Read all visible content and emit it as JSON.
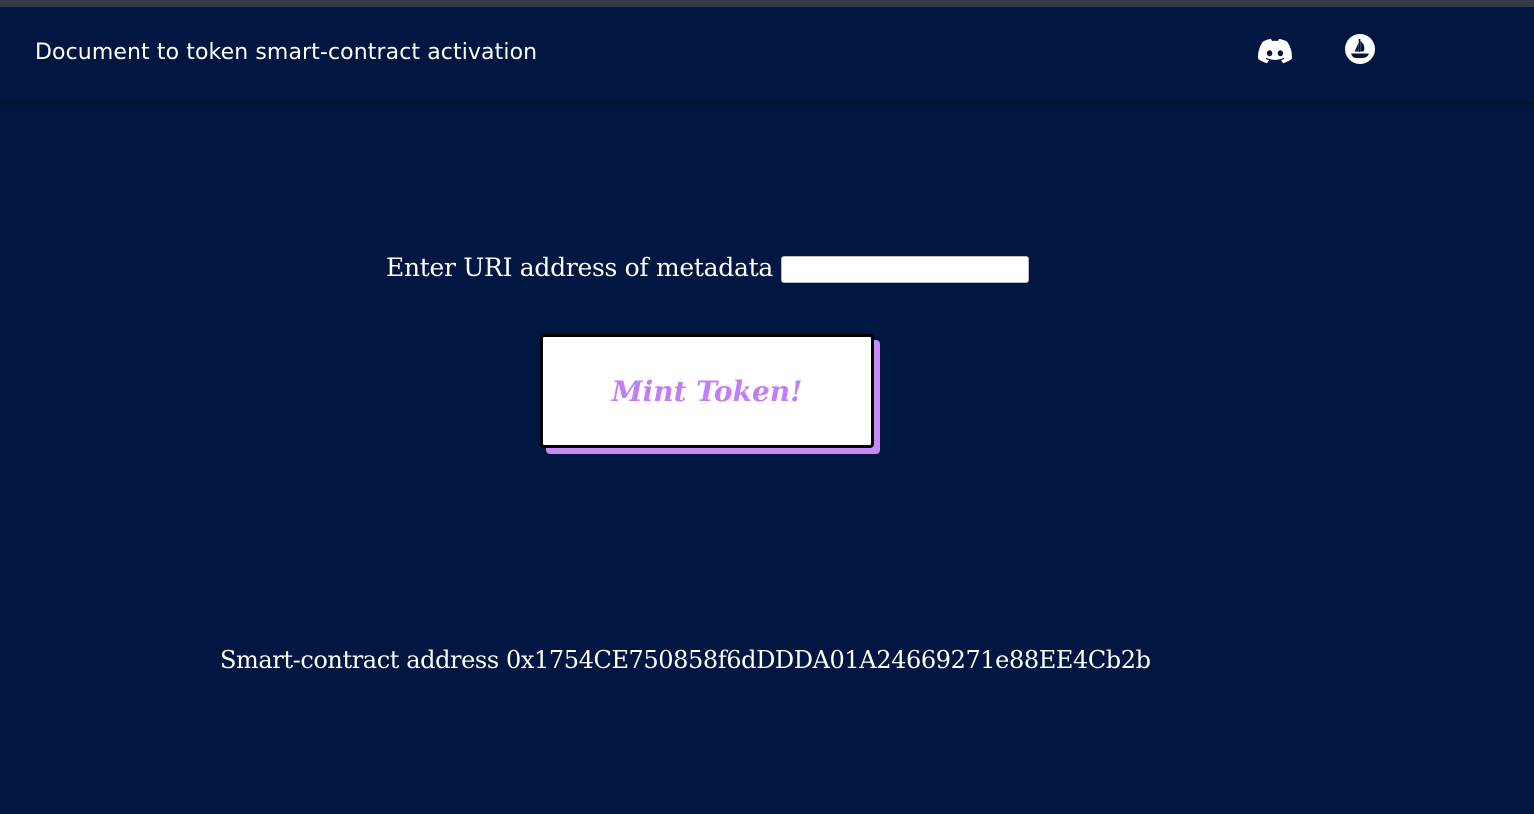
{
  "header": {
    "title": "Document to token smart-contract activation",
    "icons": [
      {
        "name": "discord-icon"
      },
      {
        "name": "opensea-icon"
      }
    ]
  },
  "form": {
    "uri_label": "Enter URI address of metadata",
    "uri_value": "",
    "uri_placeholder": ""
  },
  "mint": {
    "label": "Mint Token!"
  },
  "footer": {
    "contract_text": "Smart-contract address 0x1754CE750858f6dDDDA01A24669271e88EE4Cb2b"
  },
  "colors": {
    "background": "#011640",
    "accent": "#c27ef6",
    "shadow": "#c58af5"
  }
}
